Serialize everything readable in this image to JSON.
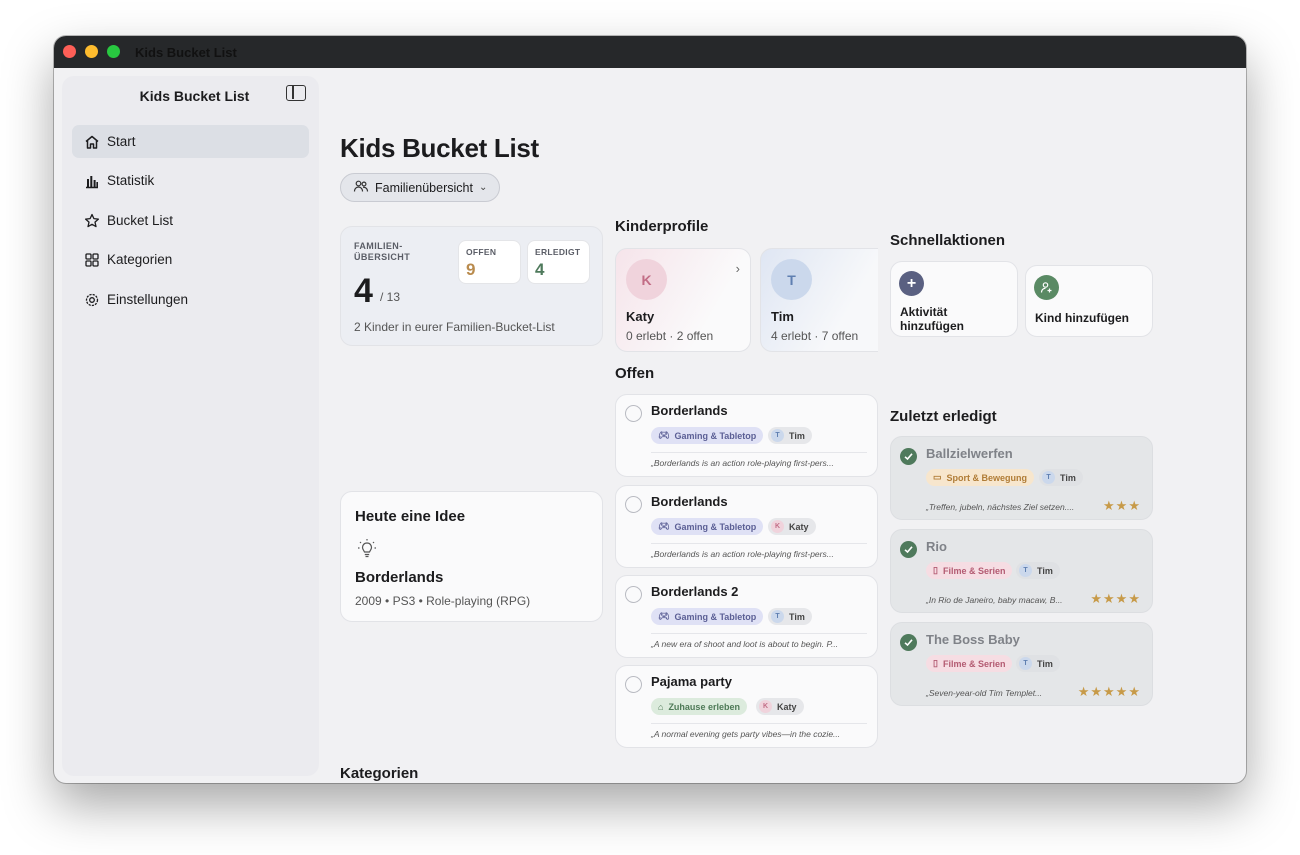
{
  "window": {
    "title": "Kids Bucket List"
  },
  "sidebar": {
    "title": "Kids Bucket List",
    "items": [
      {
        "label": "Start",
        "icon": "house-icon"
      },
      {
        "label": "Statistik",
        "icon": "bar-chart-icon"
      },
      {
        "label": "Bucket List",
        "icon": "star-icon"
      },
      {
        "label": "Kategorien",
        "icon": "grid-icon"
      },
      {
        "label": "Einstellungen",
        "icon": "gear-icon"
      }
    ]
  },
  "main": {
    "title": "Kids Bucket List",
    "filter_label": "Familienübersicht",
    "family": {
      "label_line1": "FAMILIEN-",
      "label_line2": "ÜBERSICHT",
      "count": "4",
      "total": "/ 13",
      "open_label": "OFFEN",
      "open_value": "9",
      "done_label": "ERLEDIGT",
      "done_value": "4",
      "note": "2 Kinder in eurer Familien-Bucket-List"
    },
    "idea": {
      "heading": "Heute eine Idee",
      "name": "Borderlands",
      "meta": "2009 • PS3 • Role-playing (RPG)"
    },
    "kids_heading": "Kinderprofile",
    "kids": [
      {
        "initial": "K",
        "name": "Katy",
        "stats": "0 erlebt · 2 offen"
      },
      {
        "initial": "T",
        "name": "Tim",
        "stats": "4 erlebt · 7 offen"
      }
    ],
    "open_heading": "Offen",
    "open_items": [
      {
        "title": "Borderlands",
        "category": "Gaming & Tabletop",
        "kid_initial": "T",
        "kid": "Tim",
        "quote": "„Borderlands is an action role-playing first-pers..."
      },
      {
        "title": "Borderlands",
        "category": "Gaming & Tabletop",
        "kid_initial": "K",
        "kid": "Katy",
        "quote": "„Borderlands is an action role-playing first-pers..."
      },
      {
        "title": "Borderlands 2",
        "category": "Gaming & Tabletop",
        "kid_initial": "T",
        "kid": "Tim",
        "quote": "„A new era of shoot and loot is about to begin. P..."
      },
      {
        "title": "Pajama party",
        "category": "Zuhause erleben",
        "kid_initial": "K",
        "kid": "Katy",
        "quote": "„A normal evening gets party vibes—in the cozie..."
      }
    ],
    "quick_heading": "Schnellaktionen",
    "quick": {
      "add_activity": "Aktivität hinzufügen",
      "add_kid": "Kind hinzufügen"
    },
    "recent_heading": "Zuletzt erledigt",
    "recent": [
      {
        "title": "Ballzielwerfen",
        "category": "Sport & Bewegung",
        "kid_initial": "T",
        "kid": "Tim",
        "quote": "„Treffen, jubeln, nächstes Ziel setzen....",
        "stars": "★★★",
        "rating": 3
      },
      {
        "title": "Rio",
        "category": "Filme & Serien",
        "kid_initial": "T",
        "kid": "Tim",
        "quote": "„In Rio de Janeiro, baby macaw, B...",
        "stars": "★★★★",
        "rating": 4
      },
      {
        "title": "The Boss Baby",
        "category": "Filme & Serien",
        "kid_initial": "T",
        "kid": "Tim",
        "quote": "„Seven-year-old Tim Templet...",
        "stars": "★★★★★",
        "rating": 5
      }
    ],
    "categories_heading": "Kategorien"
  },
  "colors": {
    "accent_open": "#b98b4e",
    "accent_done": "#4f7a5c",
    "gaming_tag": "#dfe1f5",
    "home_tag": "#dcebdd",
    "sport_tag": "#f7e6cd",
    "film_tag": "#f6dde3"
  }
}
